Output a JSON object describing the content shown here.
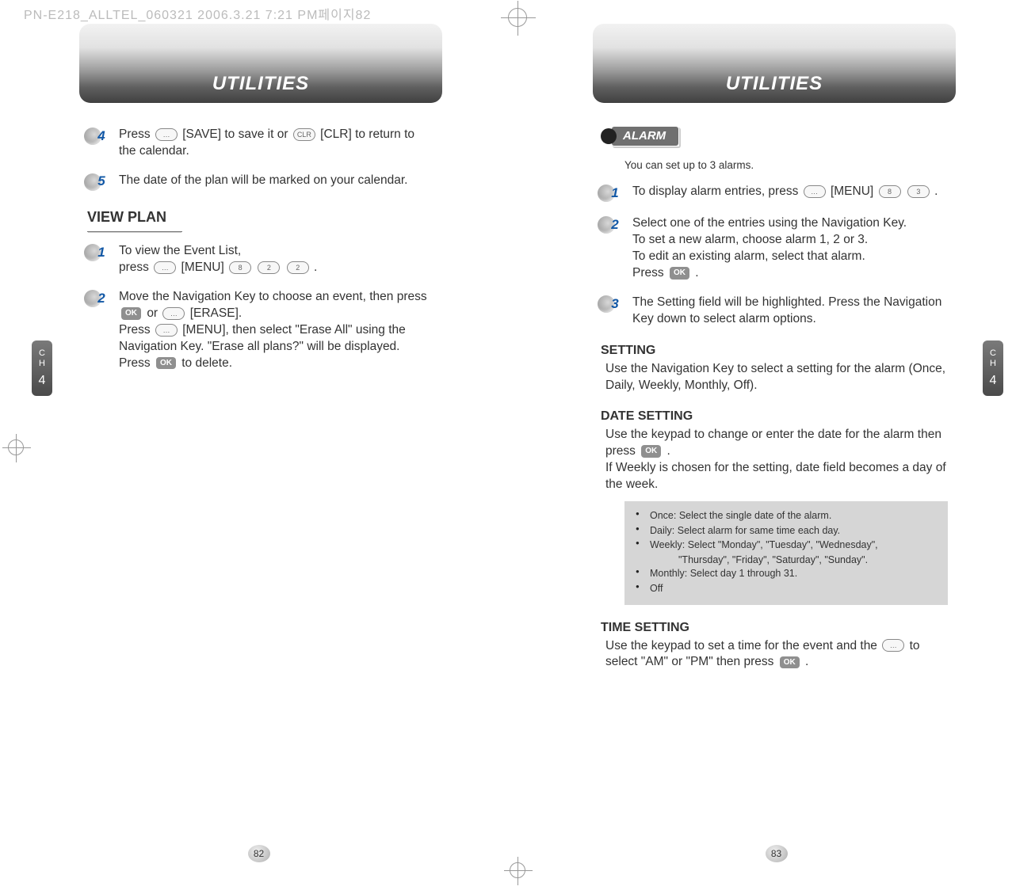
{
  "watermark": "PN-E218_ALLTEL_060321  2006.3.21 7:21 PM페이지82",
  "left_page": {
    "header": "UTILITIES",
    "ch_label_top": "C\nH",
    "ch_label_num": "4",
    "step4": {
      "num": "4",
      "text_a": "Press ",
      "key1": "…",
      "text_b": " [SAVE] to save it or ",
      "key2": "CLR",
      "text_c": " [CLR] to return to the calendar."
    },
    "step5": {
      "num": "5",
      "text": "The date of the plan will be marked on your calendar."
    },
    "section_view_plan": "VIEW PLAN",
    "vp_step1": {
      "num": "1",
      "text_a": "To view the Event List,",
      "text_b": "press ",
      "key_menu": "…",
      "label_menu": " [MENU] ",
      "key_a": "8",
      "key_b": "2",
      "key_c": "2",
      "text_c": " ."
    },
    "vp_step2": {
      "num": "2",
      "text_a": "Move the Navigation Key to choose an event, then press ",
      "ok": "OK",
      "text_b": " or ",
      "key_erase": "…",
      "label_erase": " [ERASE].",
      "text_c": "Press ",
      "key_menu2": "…",
      "text_d": " [MENU], then select \"Erase All\" using the Navigation Key.  \"Erase all plans?\" will be displayed. Press ",
      "ok2": "OK",
      "text_e": " to delete."
    },
    "page_num": "82"
  },
  "right_page": {
    "header": "UTILITIES",
    "ch_label_top": "C\nH",
    "ch_label_num": "4",
    "alarm_label": "ALARM",
    "intro": "You can set up to 3 alarms.",
    "a_step1": {
      "num": "1",
      "text_a": "To display alarm entries, press ",
      "key_menu": "…",
      "label_menu": " [MENU] ",
      "key_a": "8",
      "key_b": "3",
      "text_b": " ."
    },
    "a_step2": {
      "num": "2",
      "line1": "Select one of the entries using the Navigation Key.",
      "line2": "To set a new alarm, choose alarm 1, 2 or 3.",
      "line3": "To edit an existing alarm, select that alarm.",
      "line4a": "Press ",
      "ok": "OK",
      "line4b": " ."
    },
    "a_step3": {
      "num": "3",
      "text": "The Setting field will be highlighted. Press the Navigation Key down to select alarm options."
    },
    "setting_h": "SETTING",
    "setting_body": "Use the Navigation Key to select a setting for the alarm (Once, Daily, Weekly, Monthly, Off).",
    "date_h": "DATE SETTING",
    "date_body_a": "Use the keypad to change or enter the date for the alarm then press ",
    "date_ok": "OK",
    "date_body_b": " .",
    "date_body_c": "If Weekly is chosen for the setting, date field becomes a day of the week.",
    "note": {
      "once": "Once: Select the single date of the alarm.",
      "daily": "Daily: Select alarm for same time each day.",
      "weekly_a": "Weekly: Select \"Monday\", \"Tuesday\", \"Wednesday\",",
      "weekly_b": "\"Thursday\", \"Friday\", \"Saturday\", \"Sunday\".",
      "monthly": "Monthly: Select day 1 through 31.",
      "off": "Off"
    },
    "time_h": "TIME SETTING",
    "time_body_a": "Use the keypad to set a time for the event and the ",
    "time_key": "…",
    "time_body_b": " to select \"AM\" or \"PM\" then press ",
    "time_ok": "OK",
    "time_body_c": " .",
    "page_num": "83"
  }
}
